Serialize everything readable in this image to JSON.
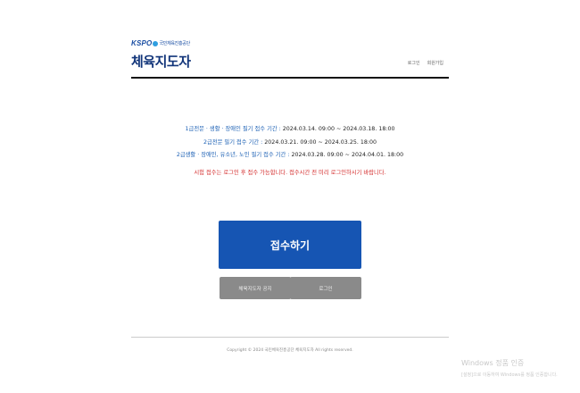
{
  "header": {
    "logo_mark": "KSPO",
    "logo_org": "국민체육진흥공단",
    "title": "체육지도자",
    "links": [
      "로그인",
      "회원가입"
    ]
  },
  "notices": {
    "line1": {
      "label": "1급전문 · 생활 · 장애인 필기 접수 기간 : ",
      "dates": "2024.03.14. 09:00 ~ 2024.03.18. 18:00"
    },
    "line2": {
      "label": "2급전문 필기 접수 기간 : ",
      "dates": "2024.03.21. 09:00 ~ 2024.03.25. 18:00"
    },
    "line3": {
      "label": "2급생활 · 장애인, 유소년, 노인 필기 접수 기간 : ",
      "dates": "2024.03.28. 09:00 ~ 2024.04.01. 18:00"
    },
    "warning": "시험 접수는 로그인 후 접수 가능합니다. 접수시간 전 미리 로그인하시기 바랍니다."
  },
  "buttons": {
    "apply": "접수하기",
    "notice": "체육지도자 공지",
    "login": "로그인"
  },
  "footer": {
    "copyright": "Copyright © 2024 국민체육진흥공단 체육지도자 All rights reserved."
  },
  "watermark": {
    "title": "Windows 정품 인증",
    "subtitle": "[설정]으로 이동하여 Windows를 정품 인증합니다."
  }
}
